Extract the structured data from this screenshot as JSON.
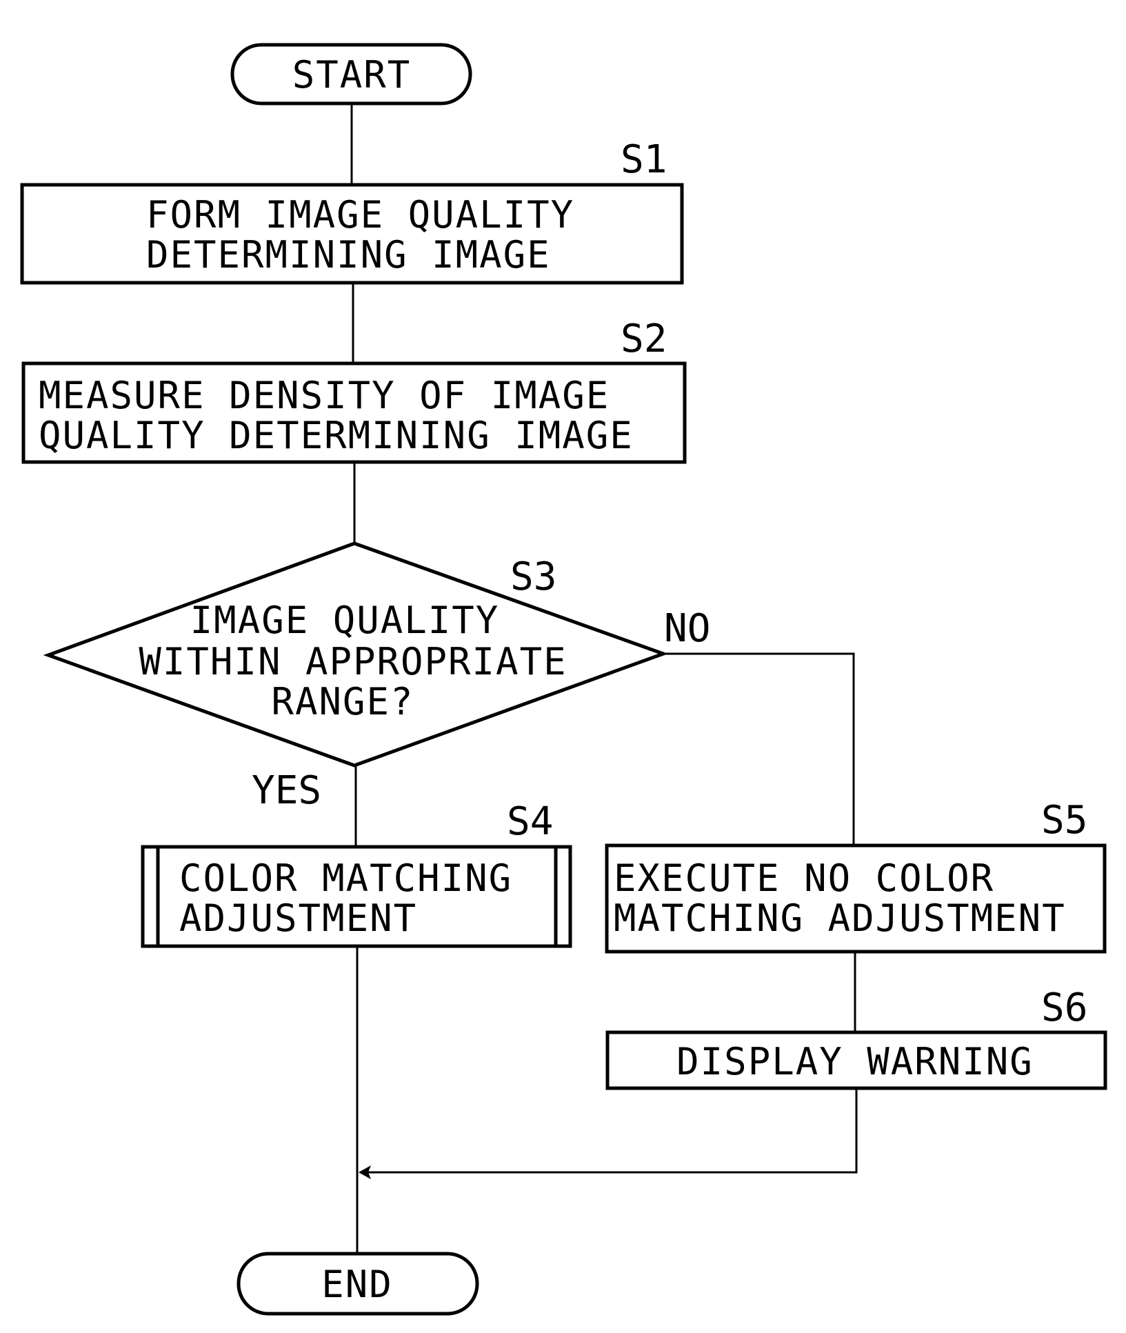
{
  "flowchart": {
    "start": {
      "label": "START"
    },
    "end": {
      "label": "END"
    },
    "steps": [
      {
        "id": "S1",
        "lines": [
          "FORM IMAGE QUALITY",
          "DETERMINING IMAGE"
        ],
        "type": "process"
      },
      {
        "id": "S2",
        "lines": [
          "MEASURE DENSITY OF IMAGE",
          "QUALITY DETERMINING IMAGE"
        ],
        "type": "process"
      },
      {
        "id": "S3",
        "lines": [
          "IMAGE QUALITY",
          "WITHIN APPROPRIATE",
          "RANGE?"
        ],
        "type": "decision"
      },
      {
        "id": "S4",
        "lines": [
          "COLOR MATCHING",
          "ADJUSTMENT"
        ],
        "type": "subroutine"
      },
      {
        "id": "S5",
        "lines": [
          "EXECUTE NO COLOR",
          "MATCHING ADJUSTMENT"
        ],
        "type": "process"
      },
      {
        "id": "S6",
        "lines": [
          "DISPLAY WARNING"
        ],
        "type": "process"
      }
    ],
    "branches": {
      "yes": "YES",
      "no": "NO"
    },
    "step_labels": {
      "s1": "S1",
      "s2": "S2",
      "s3": "S3",
      "s4": "S4",
      "s5": "S5",
      "s6": "S6"
    }
  }
}
